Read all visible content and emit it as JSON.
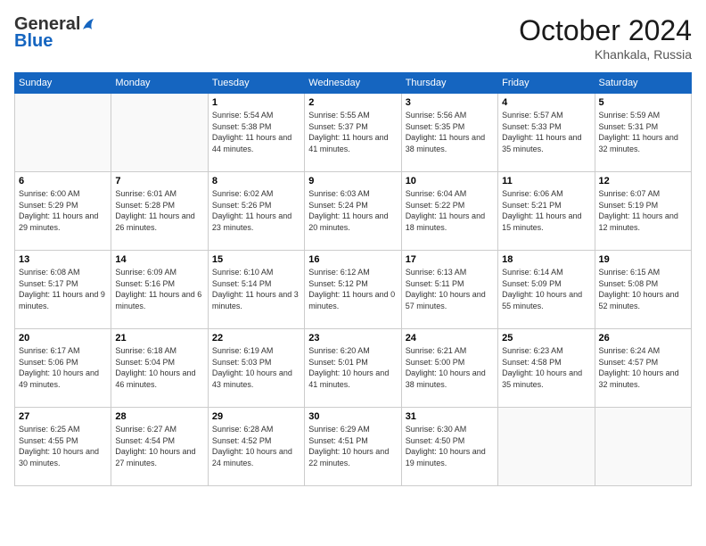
{
  "header": {
    "logo_general": "General",
    "logo_blue": "Blue",
    "month_title": "October 2024",
    "location": "Khankala, Russia"
  },
  "weekdays": [
    "Sunday",
    "Monday",
    "Tuesday",
    "Wednesday",
    "Thursday",
    "Friday",
    "Saturday"
  ],
  "weeks": [
    [
      {
        "day": "",
        "info": ""
      },
      {
        "day": "",
        "info": ""
      },
      {
        "day": "1",
        "info": "Sunrise: 5:54 AM\nSunset: 5:38 PM\nDaylight: 11 hours and 44 minutes."
      },
      {
        "day": "2",
        "info": "Sunrise: 5:55 AM\nSunset: 5:37 PM\nDaylight: 11 hours and 41 minutes."
      },
      {
        "day": "3",
        "info": "Sunrise: 5:56 AM\nSunset: 5:35 PM\nDaylight: 11 hours and 38 minutes."
      },
      {
        "day": "4",
        "info": "Sunrise: 5:57 AM\nSunset: 5:33 PM\nDaylight: 11 hours and 35 minutes."
      },
      {
        "day": "5",
        "info": "Sunrise: 5:59 AM\nSunset: 5:31 PM\nDaylight: 11 hours and 32 minutes."
      }
    ],
    [
      {
        "day": "6",
        "info": "Sunrise: 6:00 AM\nSunset: 5:29 PM\nDaylight: 11 hours and 29 minutes."
      },
      {
        "day": "7",
        "info": "Sunrise: 6:01 AM\nSunset: 5:28 PM\nDaylight: 11 hours and 26 minutes."
      },
      {
        "day": "8",
        "info": "Sunrise: 6:02 AM\nSunset: 5:26 PM\nDaylight: 11 hours and 23 minutes."
      },
      {
        "day": "9",
        "info": "Sunrise: 6:03 AM\nSunset: 5:24 PM\nDaylight: 11 hours and 20 minutes."
      },
      {
        "day": "10",
        "info": "Sunrise: 6:04 AM\nSunset: 5:22 PM\nDaylight: 11 hours and 18 minutes."
      },
      {
        "day": "11",
        "info": "Sunrise: 6:06 AM\nSunset: 5:21 PM\nDaylight: 11 hours and 15 minutes."
      },
      {
        "day": "12",
        "info": "Sunrise: 6:07 AM\nSunset: 5:19 PM\nDaylight: 11 hours and 12 minutes."
      }
    ],
    [
      {
        "day": "13",
        "info": "Sunrise: 6:08 AM\nSunset: 5:17 PM\nDaylight: 11 hours and 9 minutes."
      },
      {
        "day": "14",
        "info": "Sunrise: 6:09 AM\nSunset: 5:16 PM\nDaylight: 11 hours and 6 minutes."
      },
      {
        "day": "15",
        "info": "Sunrise: 6:10 AM\nSunset: 5:14 PM\nDaylight: 11 hours and 3 minutes."
      },
      {
        "day": "16",
        "info": "Sunrise: 6:12 AM\nSunset: 5:12 PM\nDaylight: 11 hours and 0 minutes."
      },
      {
        "day": "17",
        "info": "Sunrise: 6:13 AM\nSunset: 5:11 PM\nDaylight: 10 hours and 57 minutes."
      },
      {
        "day": "18",
        "info": "Sunrise: 6:14 AM\nSunset: 5:09 PM\nDaylight: 10 hours and 55 minutes."
      },
      {
        "day": "19",
        "info": "Sunrise: 6:15 AM\nSunset: 5:08 PM\nDaylight: 10 hours and 52 minutes."
      }
    ],
    [
      {
        "day": "20",
        "info": "Sunrise: 6:17 AM\nSunset: 5:06 PM\nDaylight: 10 hours and 49 minutes."
      },
      {
        "day": "21",
        "info": "Sunrise: 6:18 AM\nSunset: 5:04 PM\nDaylight: 10 hours and 46 minutes."
      },
      {
        "day": "22",
        "info": "Sunrise: 6:19 AM\nSunset: 5:03 PM\nDaylight: 10 hours and 43 minutes."
      },
      {
        "day": "23",
        "info": "Sunrise: 6:20 AM\nSunset: 5:01 PM\nDaylight: 10 hours and 41 minutes."
      },
      {
        "day": "24",
        "info": "Sunrise: 6:21 AM\nSunset: 5:00 PM\nDaylight: 10 hours and 38 minutes."
      },
      {
        "day": "25",
        "info": "Sunrise: 6:23 AM\nSunset: 4:58 PM\nDaylight: 10 hours and 35 minutes."
      },
      {
        "day": "26",
        "info": "Sunrise: 6:24 AM\nSunset: 4:57 PM\nDaylight: 10 hours and 32 minutes."
      }
    ],
    [
      {
        "day": "27",
        "info": "Sunrise: 6:25 AM\nSunset: 4:55 PM\nDaylight: 10 hours and 30 minutes."
      },
      {
        "day": "28",
        "info": "Sunrise: 6:27 AM\nSunset: 4:54 PM\nDaylight: 10 hours and 27 minutes."
      },
      {
        "day": "29",
        "info": "Sunrise: 6:28 AM\nSunset: 4:52 PM\nDaylight: 10 hours and 24 minutes."
      },
      {
        "day": "30",
        "info": "Sunrise: 6:29 AM\nSunset: 4:51 PM\nDaylight: 10 hours and 22 minutes."
      },
      {
        "day": "31",
        "info": "Sunrise: 6:30 AM\nSunset: 4:50 PM\nDaylight: 10 hours and 19 minutes."
      },
      {
        "day": "",
        "info": ""
      },
      {
        "day": "",
        "info": ""
      }
    ]
  ]
}
